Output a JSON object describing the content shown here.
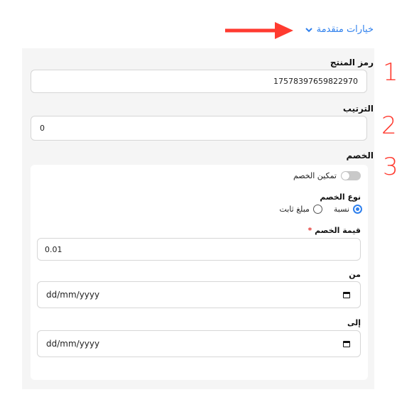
{
  "advanced": {
    "label": "خيارات متقدمة"
  },
  "fields": {
    "product_code": {
      "label": "رمز المنتج",
      "value": "17578397659822970"
    },
    "sort_order": {
      "label": "الترتيب",
      "value": "0"
    },
    "discount_section": {
      "label": "الخصم"
    }
  },
  "discount": {
    "enable_label": "تمكين الخصم",
    "type_label": "نوع الخصم",
    "type_options": [
      "نسبة",
      "مبلغ ثابت"
    ],
    "selected_type": "نسبة",
    "value_label": "قيمة الخصم",
    "required_mark": "*",
    "value": "0.01",
    "from_label": "من",
    "from_placeholder": "dd/mm/yyyy",
    "to_label": "إلى",
    "to_placeholder": "dd/mm/yyyy"
  },
  "annotations": {
    "marks": [
      "1",
      "2",
      "3"
    ]
  },
  "colors": {
    "accent": "#2f80ed",
    "radio": "#2f80ed",
    "annotation": "#ff3b30",
    "panel_bg": "#f5f5f5"
  }
}
